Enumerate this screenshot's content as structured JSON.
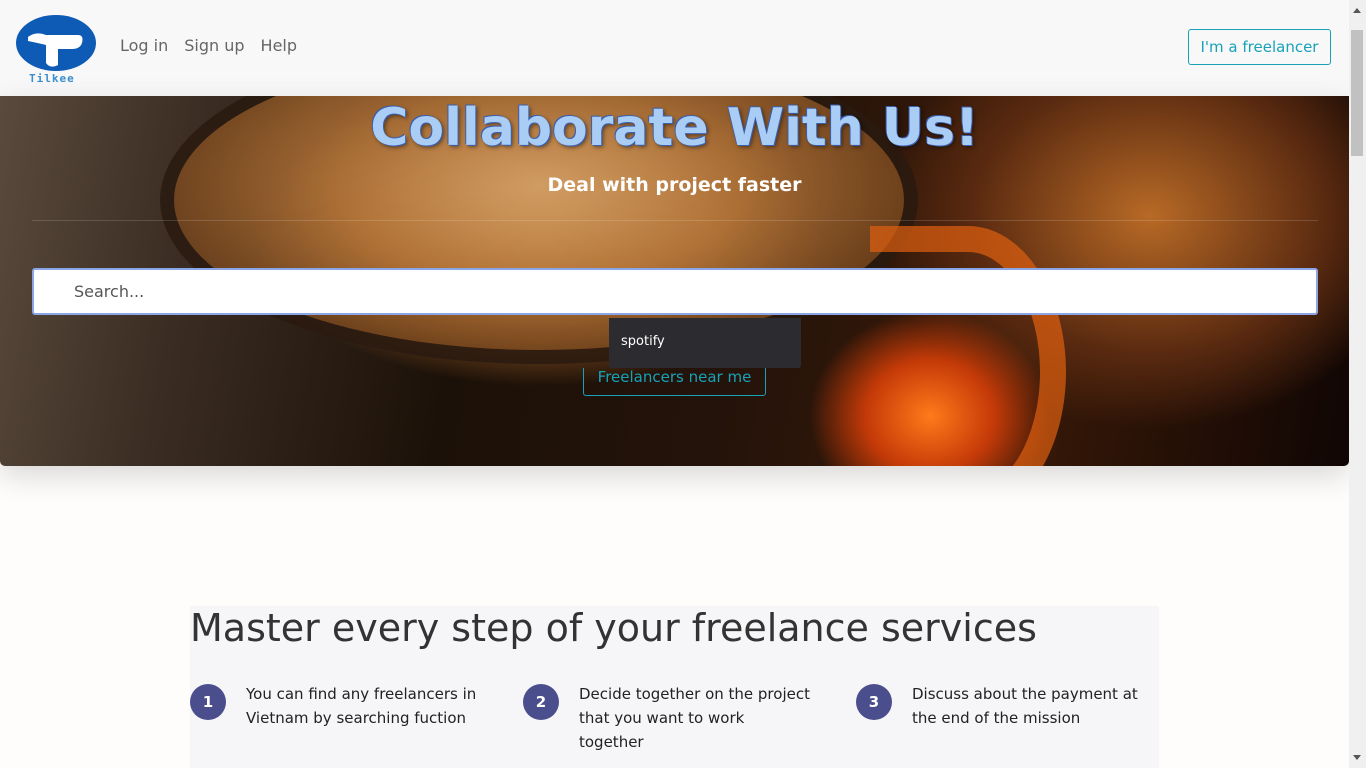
{
  "brand": {
    "name": "Tilkee",
    "logo_color": "#0d5bb5"
  },
  "nav": {
    "links": [
      "Log in",
      "Sign up",
      "Help"
    ],
    "cta": "I'm a freelancer"
  },
  "hero": {
    "title": "Collaborate With Us!",
    "subtitle": "Deal with project faster",
    "search_placeholder": "Search...",
    "suggestion": "spotify",
    "near_button": "Freelancers near me"
  },
  "steps": {
    "title": "Master every step of your freelance services",
    "items": [
      {
        "num": "1",
        "text": "You can find any freelancers in Vietnam by searching fuction"
      },
      {
        "num": "2",
        "text": "Decide together on the project that you want to work together"
      },
      {
        "num": "3",
        "text": "Discuss about the payment at the end of the mission"
      }
    ]
  },
  "colors": {
    "accent": "#17a2b8",
    "step_badge": "#4a4e8c"
  }
}
